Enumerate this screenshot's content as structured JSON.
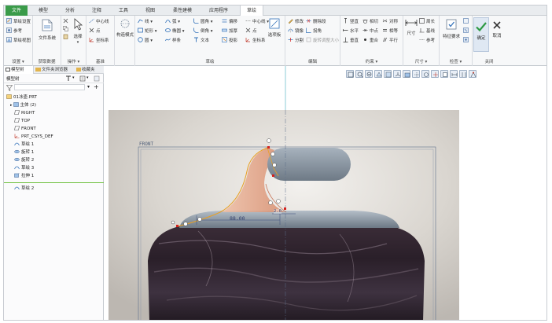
{
  "tabs": [
    {
      "label": "文件",
      "kind": "file"
    },
    {
      "label": "模型"
    },
    {
      "label": "分析"
    },
    {
      "label": "注释"
    },
    {
      "label": "工具"
    },
    {
      "label": "视图"
    },
    {
      "label": "柔性建模"
    },
    {
      "label": "应用程序"
    },
    {
      "label": "草绘",
      "kind": "active"
    }
  ],
  "ribbon": {
    "setup": {
      "items": [
        "草绘设置",
        "参考",
        "草绘视图"
      ],
      "label": "设置 ▾"
    },
    "get_data": {
      "file_system": "文件系统",
      "label": "获取数据"
    },
    "operations": {
      "select": "选择",
      "label": "操作 ▾"
    },
    "datum": {
      "items": [
        "中心线",
        "点",
        "坐标系"
      ],
      "label": "基准"
    },
    "construction": {
      "label": "构造模式"
    },
    "sketch": {
      "col1": [
        "线 ▾",
        "矩形 ▾",
        "圆 ▾"
      ],
      "col2": [
        "弧 ▾",
        "椭圆 ▾",
        "样条"
      ],
      "col3": [
        "圆角 ▾",
        "倒角 ▾",
        "文本"
      ],
      "col4": [
        "偏移",
        "加厚",
        "投影"
      ],
      "col5": [
        "中心线 ▾",
        "点",
        "坐标系"
      ],
      "palette": "选项板",
      "label": "草绘"
    },
    "editing": {
      "col1": [
        "修改",
        "镜像",
        "分割"
      ],
      "col2": [
        "删除段",
        "拐角",
        "旋转调整大小"
      ],
      "label": "编辑"
    },
    "constrain": {
      "col1": [
        "竖直",
        "水平",
        "垂直"
      ],
      "col2": [
        "相切",
        "中点",
        "重合"
      ],
      "col3": [
        "对称",
        "相等",
        "平行"
      ],
      "label": "约束 ▾"
    },
    "dimension": {
      "main": "尺寸",
      "items": [
        "周长",
        "基线",
        "参考"
      ],
      "label": "尺寸 ▾"
    },
    "inspect": {
      "feature_req": "特征要求",
      "label": "检查 ▾"
    },
    "close": {
      "ok": "确定",
      "cancel": "取消",
      "label": "关闭"
    }
  },
  "panel": {
    "tabs": [
      "模型树",
      "文件夹浏览器",
      "收藏夹"
    ],
    "tree_title": "模型树",
    "tree": [
      {
        "label": "01冰壶.PRT",
        "icon": "part-icon",
        "indent": 0
      },
      {
        "label": "主体 (2)",
        "icon": "body-icon",
        "indent": 1
      },
      {
        "label": "RIGHT",
        "icon": "plane-icon",
        "indent": 1
      },
      {
        "label": "TOP",
        "icon": "plane-icon",
        "indent": 1
      },
      {
        "label": "FRONT",
        "icon": "plane-icon",
        "indent": 1
      },
      {
        "label": "PRT_CSYS_DEF",
        "icon": "csys-icon",
        "indent": 1
      },
      {
        "label": "草绘 1",
        "icon": "sketch-icon",
        "indent": 1
      },
      {
        "label": "旋转 1",
        "icon": "revolve-icon",
        "indent": 1
      },
      {
        "label": "旋转 2",
        "icon": "revolve-icon",
        "indent": 1
      },
      {
        "label": "草绘 3",
        "icon": "sketch-icon",
        "indent": 1
      },
      {
        "label": "拉伸 1",
        "icon": "extrude-icon",
        "indent": 1
      }
    ],
    "insert_item": "草绘 2"
  },
  "viewport": {
    "front_label": "FRONT",
    "dim_main": "88.00",
    "dim_small": "2.0"
  },
  "colors": {
    "file_tab": "#3a9b49",
    "handle": "#8e9aa6",
    "sketch_line": "#e8a024",
    "constraint": "#d4201c",
    "insert_line": "#6cbf3c"
  }
}
